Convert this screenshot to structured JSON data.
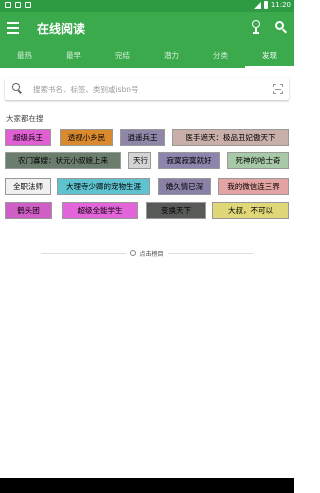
{
  "status_bar": {
    "time": "11:20"
  },
  "app_bar": {
    "title": "在线阅读"
  },
  "tabs": [
    {
      "label": "最热"
    },
    {
      "label": "最早"
    },
    {
      "label": "完结"
    },
    {
      "label": "潜力"
    },
    {
      "label": "分类"
    },
    {
      "label": "发现"
    }
  ],
  "search": {
    "placeholder": "搜索书名、标签、类别或isbn号",
    "value": ""
  },
  "section": {
    "title": "大家都在搜"
  },
  "tags": [
    {
      "label": "超级兵王",
      "bg": "#e060d4"
    },
    {
      "label": "透视小乡民",
      "bg": "#d98a2f"
    },
    {
      "label": "逍遥兵王",
      "bg": "#8f86a8"
    },
    {
      "label": "医手遮天：极品丑妃傲天下",
      "bg": "#c9afaa"
    },
    {
      "label": "农门寡嫂：状元小叔娘上来",
      "bg": "#6b7d6d"
    },
    {
      "label": "天行",
      "bg": "#d4d4d4"
    },
    {
      "label": "寂寞寂寞就好",
      "bg": "#8e84ad"
    },
    {
      "label": "死神的哈士奇",
      "bg": "#a7c9a8"
    },
    {
      "label": "全职法师",
      "bg": "#f0f0f0"
    },
    {
      "label": "大理寺少卿的宠物生涯",
      "bg": "#5ec3cf"
    },
    {
      "label": "婚久情已深",
      "bg": "#8b80a6"
    },
    {
      "label": "我的微信连三界",
      "bg": "#e3a3a2"
    },
    {
      "label": "鹤头团",
      "bg": "#cf5ec7"
    },
    {
      "label": "超级全能学生",
      "bg": "#e365da"
    },
    {
      "label": "变换天下",
      "bg": "#585a58"
    },
    {
      "label": "大叔，不可以",
      "bg": "#dfd778"
    }
  ],
  "load_more": {
    "label": "点击榜目"
  },
  "colors": {
    "primary": "#3aaa4d",
    "status": "#2e9b43"
  }
}
